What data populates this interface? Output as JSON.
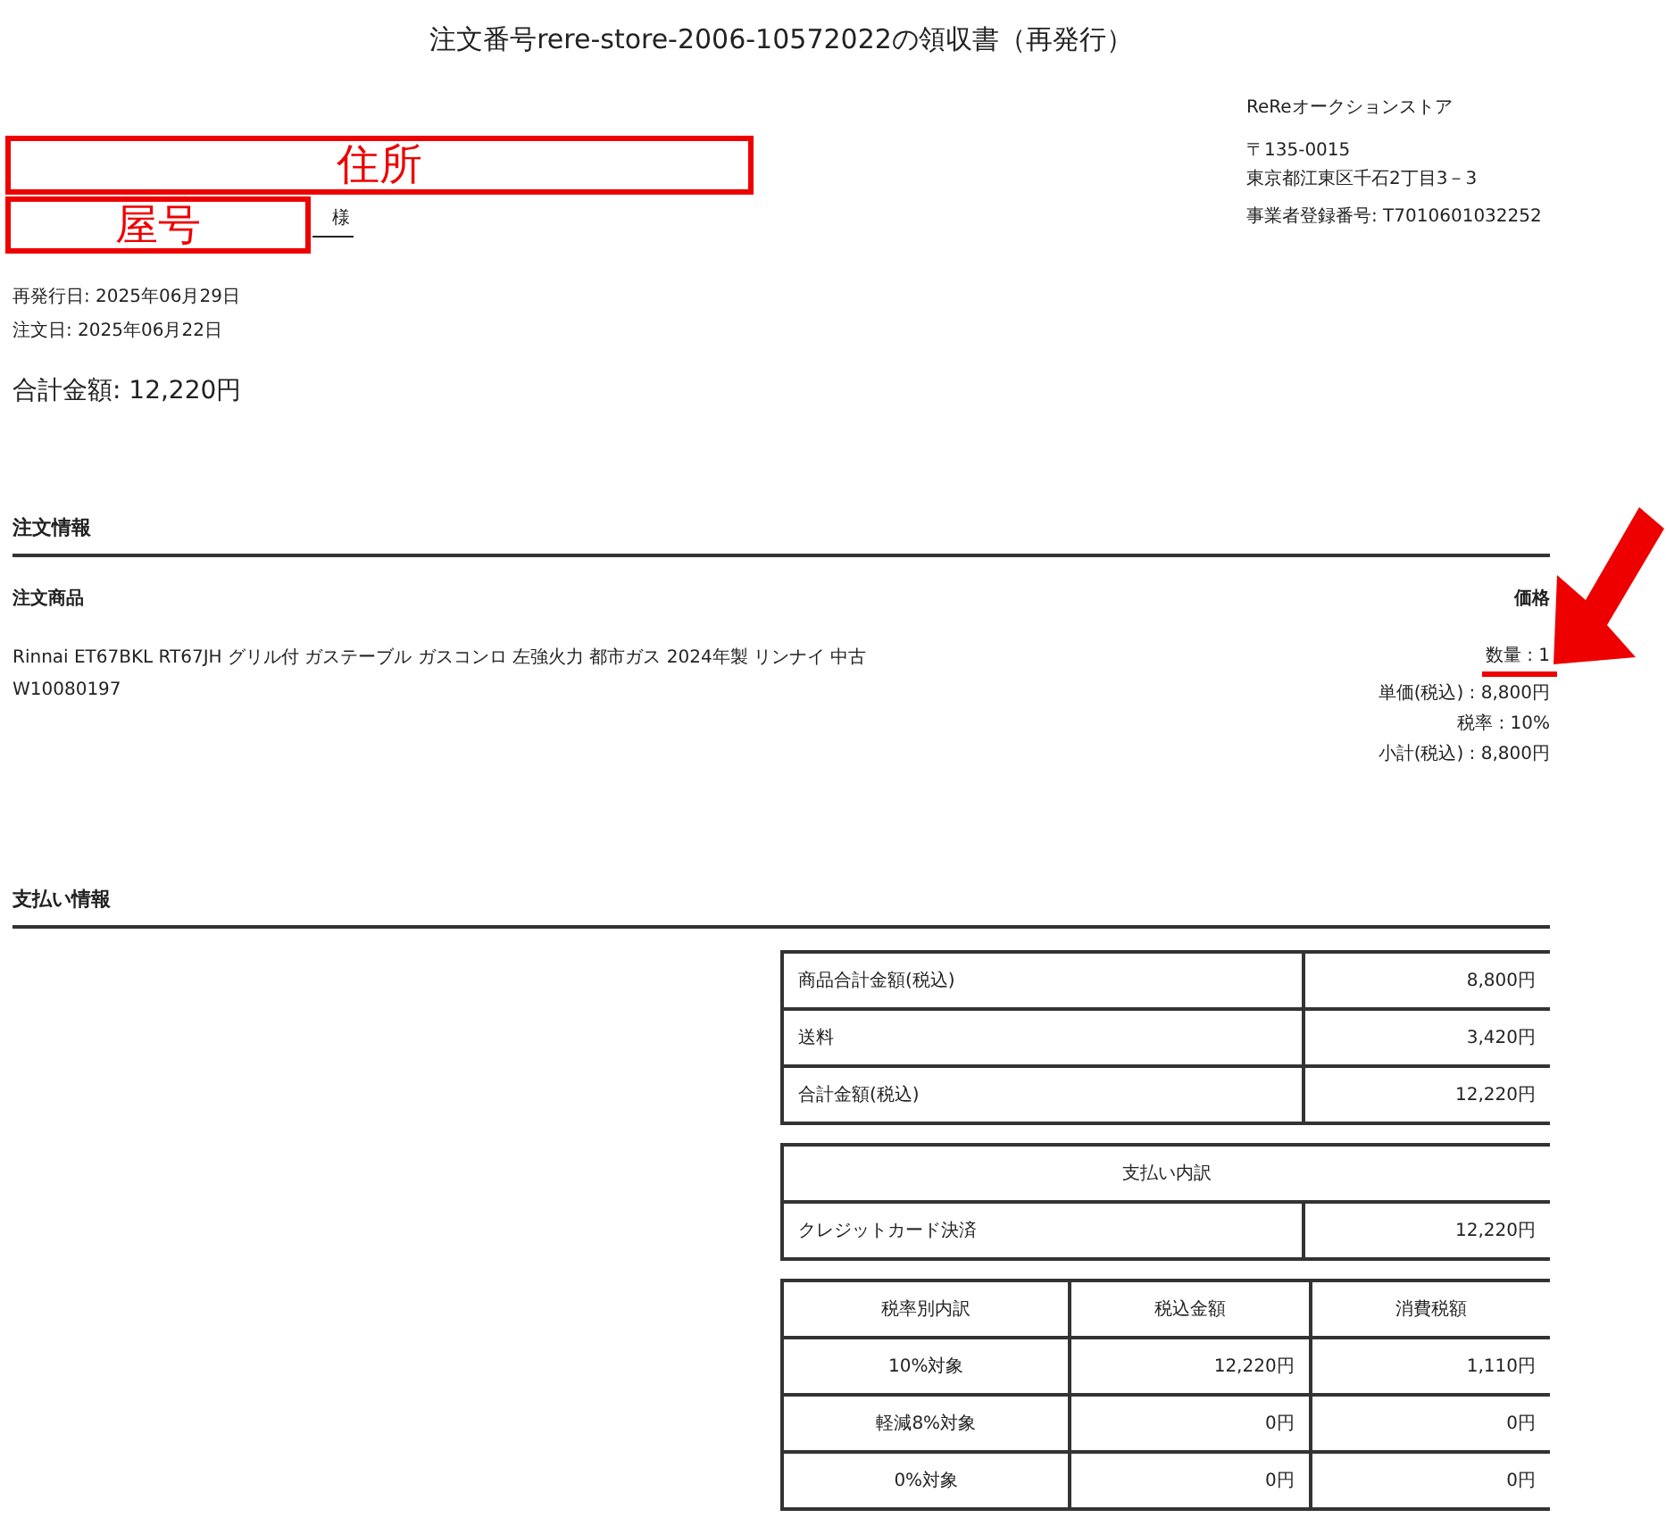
{
  "title": "注文番号rere-store-2006-10572022の領収書（再発行）",
  "store": {
    "name": "ReReオークションストア",
    "postal": "〒135-0015",
    "address": "東京都江東区千石2丁目3－3",
    "registration": "事業者登録番号: T7010601032252"
  },
  "recipient": {
    "honorific": "様"
  },
  "dates": [
    "再発行日: 2025年06月29日",
    "注文日: 2025年06月22日"
  ],
  "total": "合計金額: 12,220円",
  "order_section": {
    "heading": "注文情報",
    "item_header": "注文商品",
    "price_header": "価格",
    "item": {
      "name": "Rinnai ET67BKL RT67JH グリル付 ガステーブル ガスコンロ 左強火力 都市ガス 2024年製 リンナイ 中古",
      "code": "W10080197",
      "details": [
        "数量 : 1",
        "単価(税込) : 8,800円",
        "税率 : 10%",
        "小計(税込) : 8,800円"
      ]
    }
  },
  "payment_section": {
    "heading": "支払い情報",
    "summary_rows": [
      {
        "label": "商品合計金額(税込)",
        "value": "8,800円"
      },
      {
        "label": "送料",
        "value": "3,420円"
      },
      {
        "label": "合計金額(税込)",
        "value": "12,220円"
      }
    ],
    "breakdown": {
      "title": "支払い内訳",
      "rows": [
        {
          "label": "クレジットカード決済",
          "value": "12,220円"
        }
      ]
    },
    "tax_table": {
      "columns": [
        "税率別内訳",
        "税込金額",
        "消費税額"
      ],
      "rows": [
        [
          "10%対象",
          "12,220円",
          "1,110円"
        ],
        [
          "軽減8%対象",
          "0円",
          "0円"
        ],
        [
          "0%対象",
          "0円",
          "0円"
        ]
      ]
    }
  },
  "annotations": [
    {
      "kind": "box",
      "label": "住所"
    },
    {
      "kind": "box",
      "label": "屋号"
    },
    {
      "kind": "arrow"
    },
    {
      "kind": "underline"
    }
  ]
}
